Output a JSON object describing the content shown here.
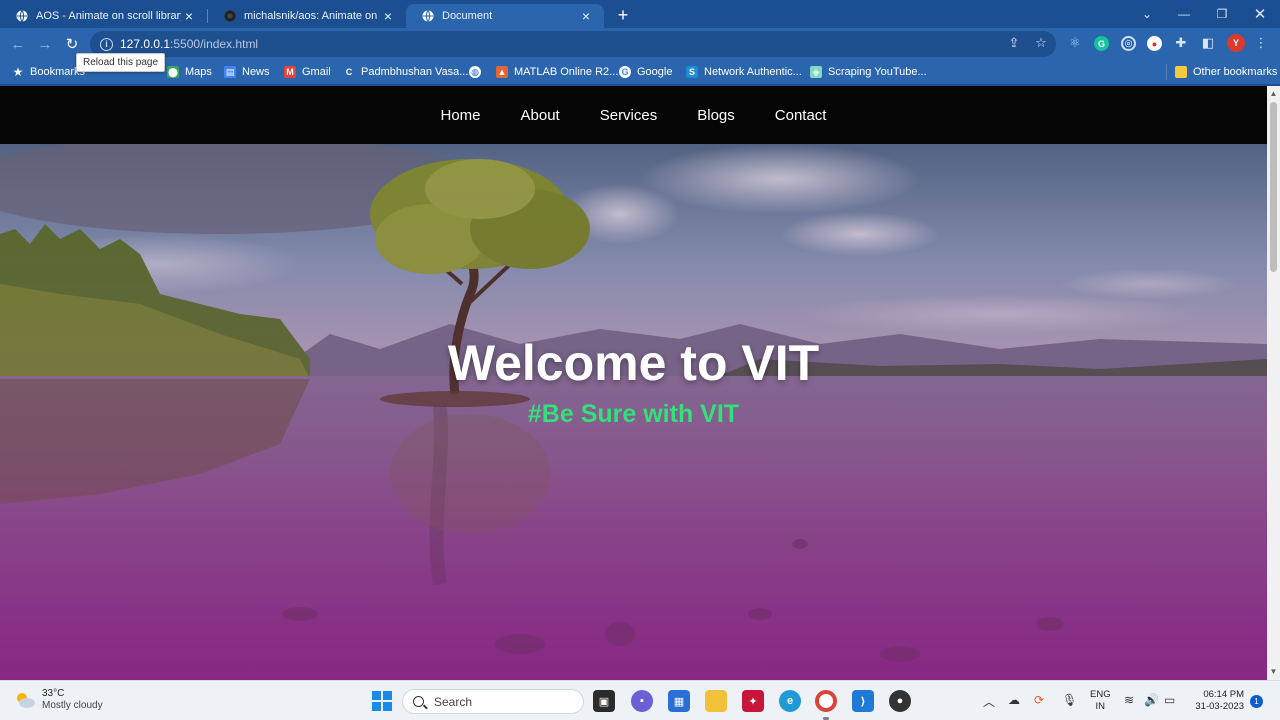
{
  "browser": {
    "tabs": [
      {
        "title": "AOS - Animate on scroll library",
        "icon": "globe-icon",
        "active": false
      },
      {
        "title": "michalsnik/aos: Animate on scroll",
        "icon": "github-icon",
        "active": false
      },
      {
        "title": "Document",
        "icon": "globe-icon",
        "active": true
      }
    ],
    "url_host": "127.0.0.1",
    "url_rest": ":5500/index.html",
    "tooltip": "Reload this page",
    "profile_initial": "Y",
    "bookmarks": [
      {
        "label": "Bookmarks",
        "icon": "star-icon"
      },
      {
        "label": "Maps",
        "icon": "maps-icon"
      },
      {
        "label": "News",
        "icon": "news-icon"
      },
      {
        "label": "Gmail",
        "icon": "gmail-icon"
      },
      {
        "label": "Padmbhushan Vasa...",
        "icon": "c-icon"
      },
      {
        "label": "",
        "icon": "globe-icon"
      },
      {
        "label": "MATLAB Online R2...",
        "icon": "matlab-icon"
      },
      {
        "label": "Google",
        "icon": "google-icon"
      },
      {
        "label": "Network Authentic...",
        "icon": "s-icon"
      },
      {
        "label": "Scraping YouTube...",
        "icon": "scrape-icon"
      }
    ],
    "other_bookmarks": "Other bookmarks"
  },
  "site": {
    "nav": [
      "Home",
      "About",
      "Services",
      "Blogs",
      "Contact"
    ],
    "hero_title": "Welcome to VIT",
    "hero_subtitle": "#Be Sure with VIT"
  },
  "taskbar": {
    "temp": "33°C",
    "condition": "Mostly cloudy",
    "search_placeholder": "Search",
    "lang_1": "ENG",
    "lang_2": "IN",
    "time": "06:14 PM",
    "date": "31-03-2023",
    "notifications": "1"
  },
  "colors": {
    "chrome_frame": "#1b4f91",
    "chrome_toolbar": "#2a65ad",
    "site_nav": "#050505",
    "hero_subtitle": "#33e07a"
  }
}
